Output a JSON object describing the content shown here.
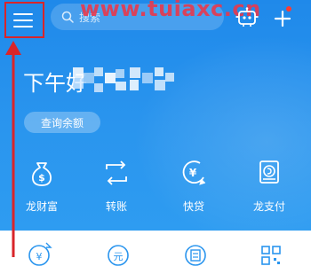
{
  "watermark": "www.tuiaxc.cn",
  "search": {
    "placeholder": "搜索"
  },
  "greeting": "下午好",
  "balance_button": "查询余额",
  "quick_actions": [
    {
      "label": "龙财富",
      "icon": "dollar-bag-icon"
    },
    {
      "label": "转账",
      "icon": "transfer-icon"
    },
    {
      "label": "快贷",
      "icon": "yen-coin-icon"
    },
    {
      "label": "龙支付",
      "icon": "phone-pay-icon"
    }
  ],
  "bottom_icons": [
    "yen-exchange-icon",
    "yuan-wallet-icon",
    "bill-icon",
    "qr-code-icon"
  ],
  "colors": {
    "primary": "#2a95ee",
    "annotation": "#d9252a"
  }
}
